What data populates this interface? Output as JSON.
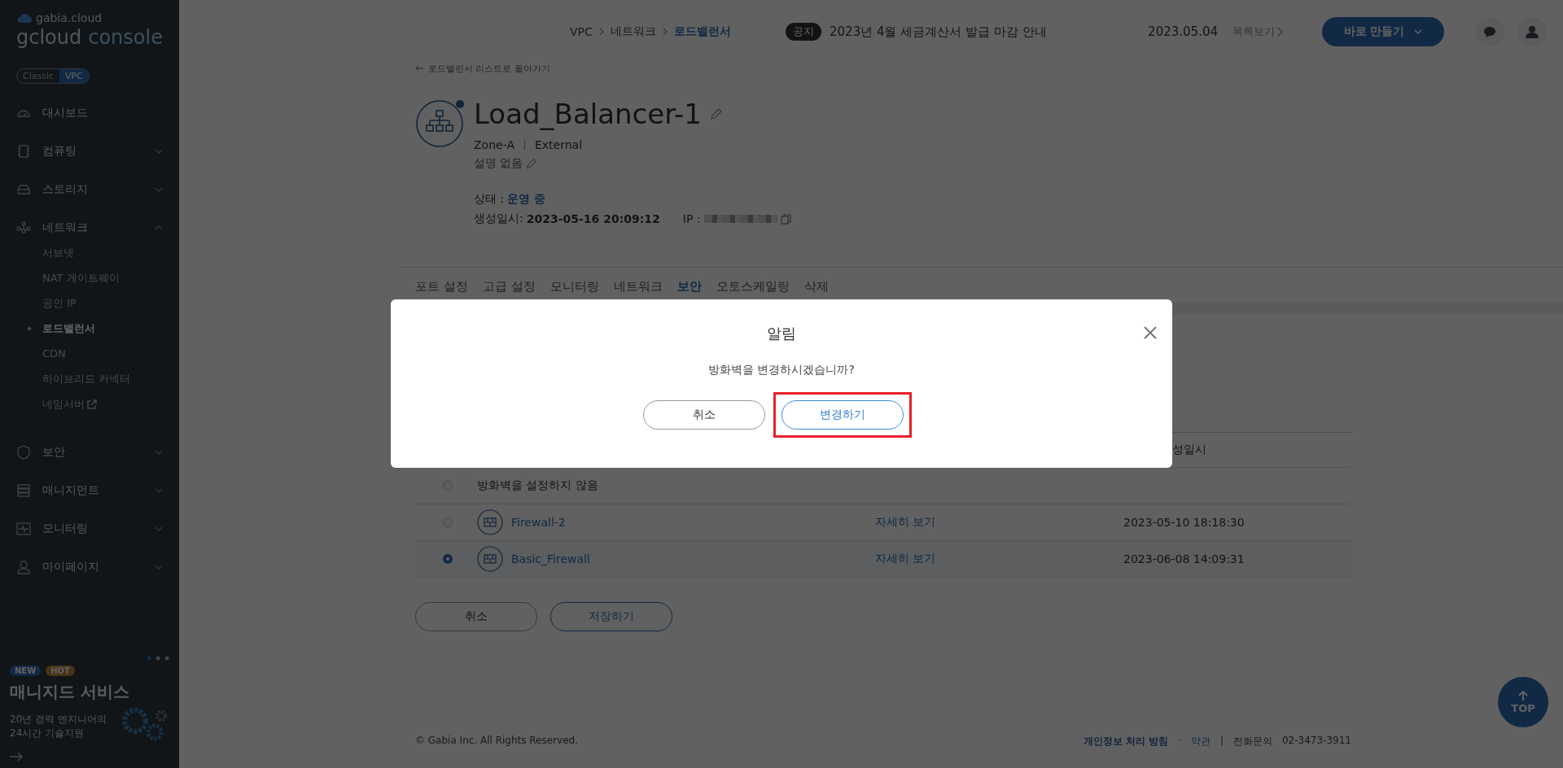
{
  "sidebar": {
    "logo_small": "gabia.cloud",
    "logo_main": "gcloud",
    "logo_sub": "console",
    "modes": [
      {
        "label": "Classic",
        "selected": false
      },
      {
        "label": "VPC",
        "selected": true
      }
    ],
    "items": [
      {
        "label": "대시보드"
      },
      {
        "label": "컴퓨팅",
        "expanded": false
      },
      {
        "label": "스토리지",
        "expanded": false
      },
      {
        "label": "네트워크",
        "expanded": true,
        "children": [
          {
            "label": "서브넷",
            "selected": false
          },
          {
            "label": "NAT 게이트웨이",
            "selected": false
          },
          {
            "label": "공인 IP",
            "selected": false
          },
          {
            "label": "로드밸런서",
            "selected": true
          },
          {
            "label": "CDN",
            "selected": false
          },
          {
            "label": "하이브리드 커넥터",
            "selected": false
          },
          {
            "label": "네임서버",
            "selected": false,
            "external": true
          }
        ]
      },
      {
        "label": "보안",
        "expanded": false
      },
      {
        "label": "매니지먼트",
        "expanded": false
      },
      {
        "label": "모니터링",
        "expanded": false
      },
      {
        "label": "마이페이지",
        "expanded": false
      }
    ],
    "banner": {
      "badges": [
        {
          "label": "NEW",
          "kind": "new"
        },
        {
          "label": "HOT",
          "kind": "hot"
        }
      ],
      "title": "매니지드 서비스",
      "lines": [
        "20년 경력 엔지니어의",
        "24시간 기술지원"
      ]
    }
  },
  "header": {
    "breadcrumb": [
      {
        "label": "VPC",
        "current": false
      },
      {
        "label": "네트워크",
        "current": false
      },
      {
        "label": "로드밸런서",
        "current": true
      }
    ],
    "notice": {
      "badge": "공지",
      "text": "2023년 4월 세금계산서 발급 마감 안내",
      "date": "2023.05.04",
      "more": "목록보기"
    },
    "create_button": "바로 만들기"
  },
  "detail": {
    "back_link": "로드밸런서 리스트로 돌아가기",
    "title": "Load_Balancer-1",
    "zone": "Zone-A",
    "type": "External",
    "description": "설명 없음",
    "status_label": "상태 :",
    "status": "운영 중",
    "created_label": "생성일시:",
    "created": "2023-05-16 20:09:12",
    "ip_label": "IP :"
  },
  "tabs": [
    {
      "label": "포트 설정",
      "selected": false
    },
    {
      "label": "고급 설정",
      "selected": false
    },
    {
      "label": "모니터링",
      "selected": false
    },
    {
      "label": "네트워크",
      "selected": false
    },
    {
      "label": "보안",
      "selected": true
    },
    {
      "label": "오토스케일링",
      "selected": false
    },
    {
      "label": "삭제",
      "selected": false
    }
  ],
  "table": {
    "column_3": "성일시",
    "rows": [
      {
        "selected": false,
        "kind": "none",
        "name": "방화벽을 설정하지 않음"
      },
      {
        "selected": false,
        "kind": "firewall",
        "name": "Firewall-2",
        "link": "자세히 보기",
        "date": "2023-05-10 18:18:30"
      },
      {
        "selected": true,
        "kind": "firewall",
        "name": "Basic_Firewall",
        "link": "자세히 보기",
        "date": "2023-06-08 14:09:31"
      }
    ]
  },
  "form_buttons": [
    "취소",
    "저장하기"
  ],
  "footer": {
    "copyright": "© Gabia Inc. All Rights Reserved.",
    "privacy": "개인정보 처리 방침",
    "sep1": "·",
    "terms": "약관",
    "sep2": "|",
    "phone_label": "전화문의",
    "phone": "02-3473-3911"
  },
  "top_button": "TOP",
  "modal": {
    "title": "알림",
    "message": "방화벽을 변경하시겠습니까?",
    "cancel": "취소",
    "confirm": "변경하기",
    "confirm_highlighted": true
  }
}
